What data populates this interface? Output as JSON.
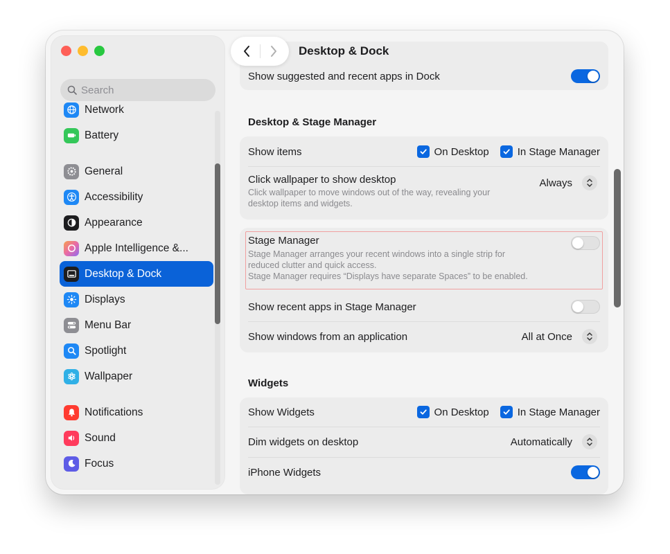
{
  "window": {
    "title": "Desktop & Dock"
  },
  "search": {
    "placeholder": "Search"
  },
  "sidebar": {
    "items": [
      {
        "label": "Network",
        "icon": "network-icon",
        "color": "#1e88f5"
      },
      {
        "label": "Battery",
        "icon": "battery-icon",
        "color": "#34c759"
      },
      {
        "label": "General",
        "icon": "gear-icon",
        "color": "#8e8e93"
      },
      {
        "label": "Accessibility",
        "icon": "accessibility-icon",
        "color": "#1e88f5"
      },
      {
        "label": "Appearance",
        "icon": "appearance-icon",
        "color": "#1d1d1f"
      },
      {
        "label": "Apple Intelligence &...",
        "icon": "apple-intelligence-icon",
        "color": "#e96aa6"
      },
      {
        "label": "Desktop & Dock",
        "icon": "dock-icon",
        "color": "#1d1d1f",
        "active": true
      },
      {
        "label": "Displays",
        "icon": "displays-icon",
        "color": "#1e88f5"
      },
      {
        "label": "Menu Bar",
        "icon": "menu-bar-icon",
        "color": "#8e8e93"
      },
      {
        "label": "Spotlight",
        "icon": "spotlight-icon",
        "color": "#1e88f5"
      },
      {
        "label": "Wallpaper",
        "icon": "wallpaper-icon",
        "color": "#30b0e6"
      },
      {
        "label": "Notifications",
        "icon": "notifications-icon",
        "color": "#ff3b30"
      },
      {
        "label": "Sound",
        "icon": "sound-icon",
        "color": "#ff3b5c"
      },
      {
        "label": "Focus",
        "icon": "focus-icon",
        "color": "#5e5ce6"
      }
    ]
  },
  "dock_section": {
    "suggested_label": "Show suggested and recent apps in Dock",
    "suggested_on": true
  },
  "desktop_stage": {
    "title": "Desktop & Stage Manager",
    "show_items_label": "Show items",
    "on_desktop_label": "On Desktop",
    "in_stage_manager_label": "In Stage Manager",
    "click_wallpaper_label": "Click wallpaper to show desktop",
    "click_wallpaper_desc_1": "Click wallpaper to move windows out of the way, revealing your",
    "click_wallpaper_desc_2": "desktop items and widgets.",
    "click_wallpaper_value": "Always",
    "stage_manager_label": "Stage Manager",
    "stage_manager_desc_1": "Stage Manager arranges your recent windows into a single strip for",
    "stage_manager_desc_2": "reduced clutter and quick access.",
    "stage_manager_desc_3": "Stage Manager requires “Displays have separate Spaces” to be enabled.",
    "stage_manager_on": false,
    "recent_apps_label": "Show recent apps in Stage Manager",
    "recent_apps_on": false,
    "show_windows_label": "Show windows from an application",
    "show_windows_value": "All at Once"
  },
  "widgets": {
    "title": "Widgets",
    "show_widgets_label": "Show Widgets",
    "on_desktop_label": "On Desktop",
    "in_stage_manager_label": "In Stage Manager",
    "dim_label": "Dim widgets on desktop",
    "dim_value": "Automatically",
    "iphone_label": "iPhone Widgets",
    "iphone_on": true
  },
  "colors": {
    "accent": "#0a67e0",
    "sidebar_active": "#0a62d8",
    "highlight": "#f0a0a0"
  }
}
